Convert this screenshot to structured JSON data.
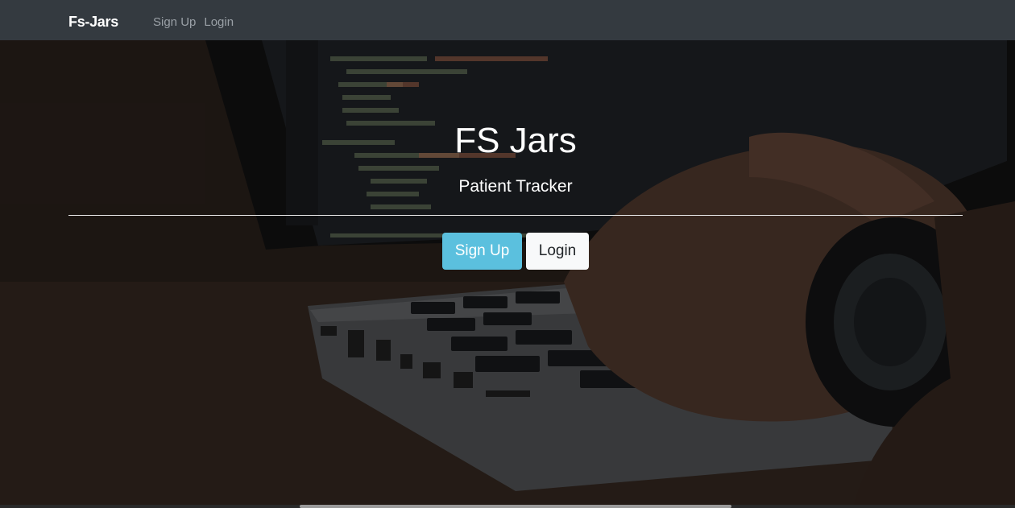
{
  "navbar": {
    "brand": "Fs-Jars",
    "links": [
      {
        "label": "Sign Up"
      },
      {
        "label": "Login"
      }
    ]
  },
  "hero": {
    "title": "FS Jars",
    "subtitle": "Patient Tracker",
    "buttons": {
      "signup_label": "Sign Up",
      "login_label": "Login"
    },
    "background_image": "laptop-coding-photo"
  },
  "colors": {
    "navbar": "#343a40",
    "signup_button": "#5bc0de",
    "login_button": "#f8f9fa"
  }
}
